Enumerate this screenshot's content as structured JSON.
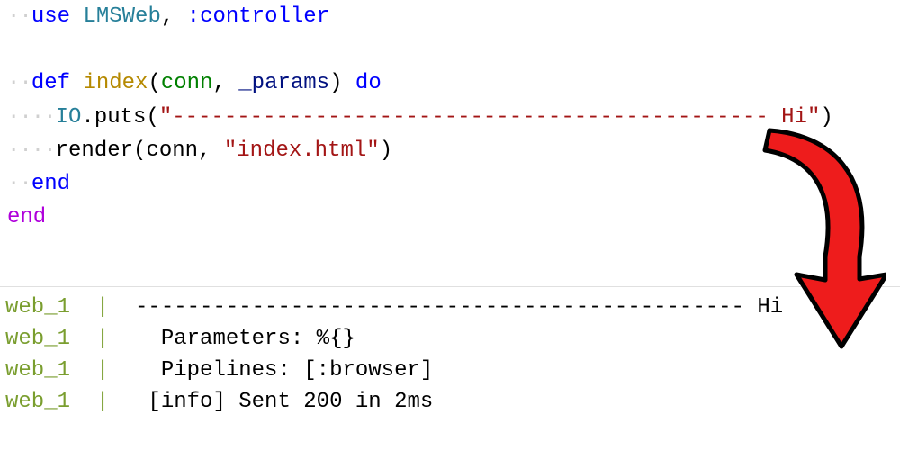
{
  "code": {
    "line1": {
      "dots": "··",
      "use": "use",
      "module": "LMSWeb",
      "comma": ", ",
      "atom": ":controller"
    },
    "line3": {
      "dots": "··",
      "def": "def",
      "fname": "index",
      "lparen": "(",
      "arg1": "conn",
      "comma": ", ",
      "arg2": "_params",
      "rparen": ") ",
      "do": "do"
    },
    "line4": {
      "dots": "····",
      "mod": "IO",
      "dot": ".",
      "fn": "puts",
      "lparen": "(",
      "str": "\"---------------------------------------------- Hi\"",
      "rparen": ")"
    },
    "line5": {
      "dots": "····",
      "fn": "render",
      "lparen": "(",
      "arg1": "conn",
      "comma": ", ",
      "str": "\"index.html\"",
      "rparen": ")"
    },
    "line6": {
      "dots": "··",
      "end": "end"
    },
    "line7": {
      "end": "end"
    }
  },
  "terminal": {
    "proc": "web_1",
    "pipe": "  | ",
    "out1": " ----------------------------------------------- Hi",
    "out2": "   Parameters: %{}",
    "out3": "   Pipelines: [:browser]",
    "out4": "  [info] Sent 200 in 2ms"
  }
}
